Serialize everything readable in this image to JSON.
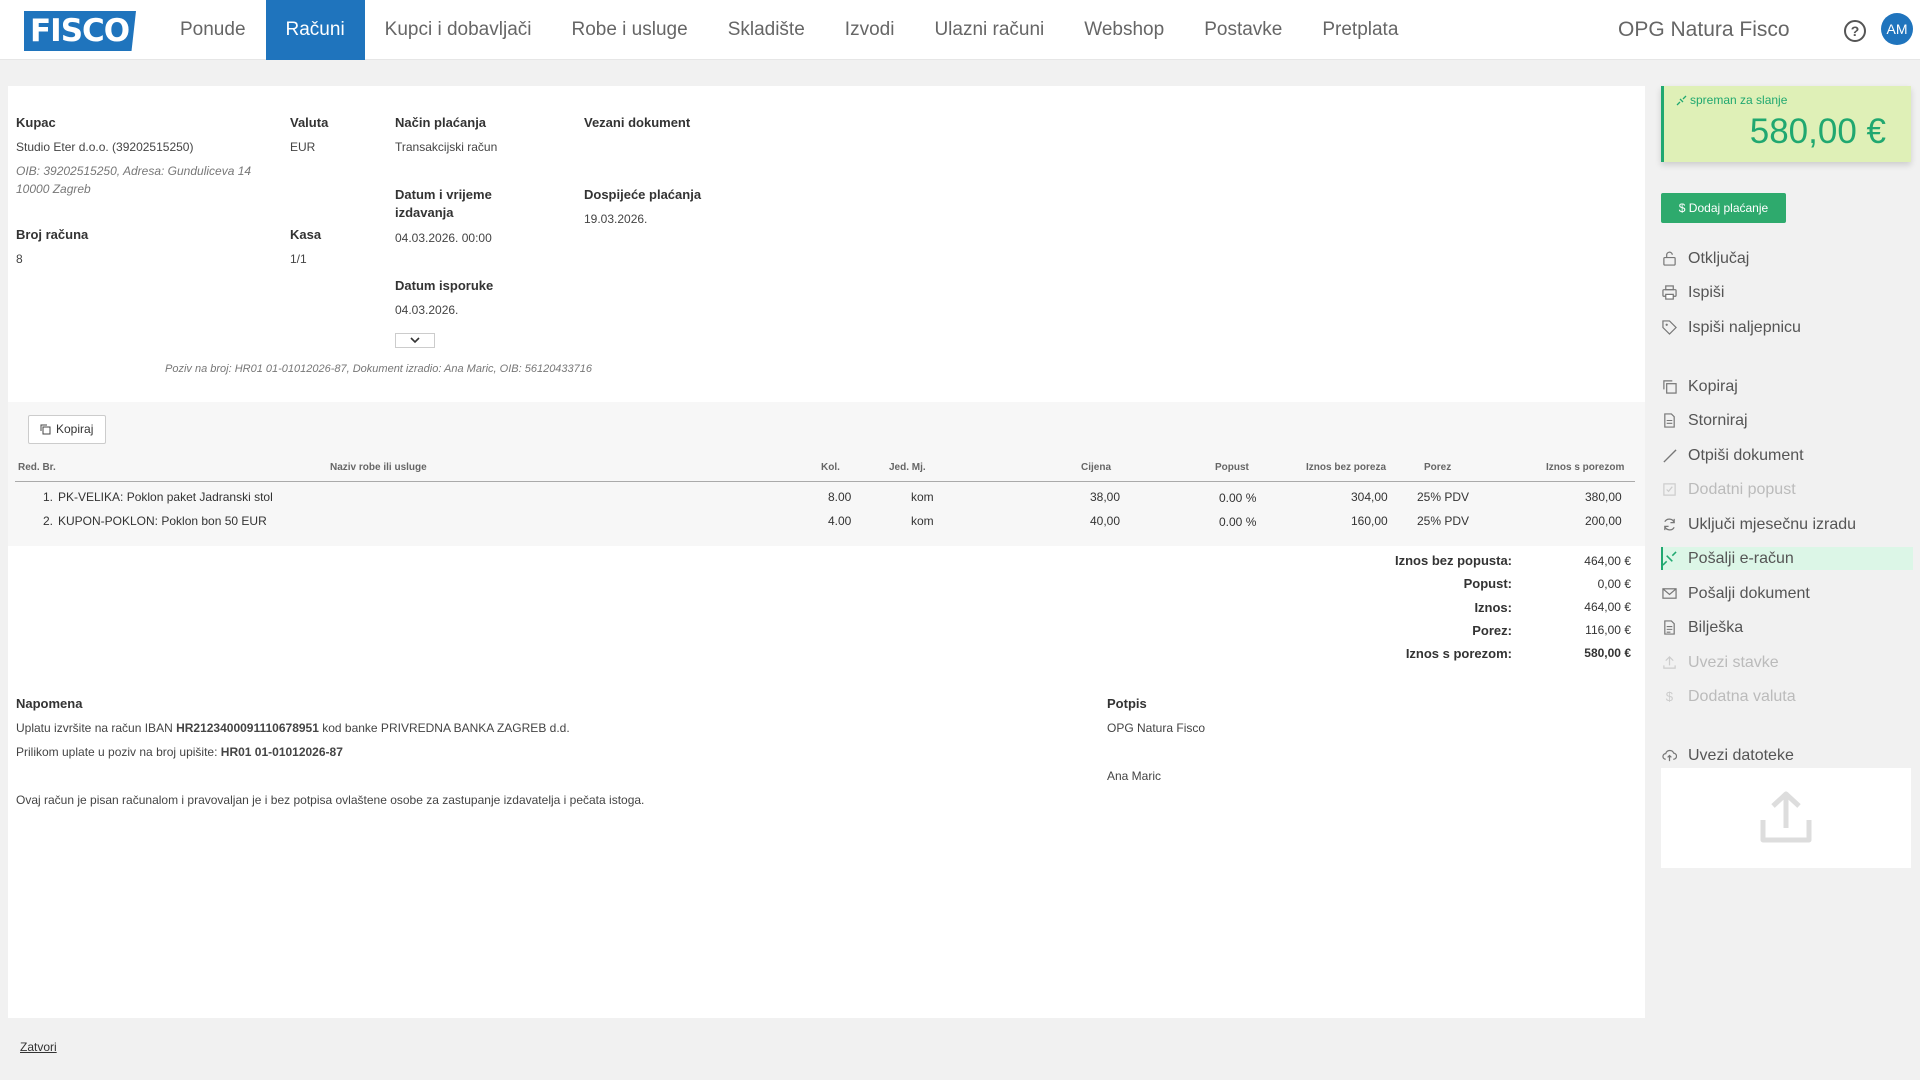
{
  "nav": {
    "logo": "FISCO",
    "items": [
      "Ponude",
      "Računi",
      "Kupci i dobavljači",
      "Robe i usluge",
      "Skladište",
      "Izvodi",
      "Ulazni računi",
      "Webshop",
      "Postavke",
      "Pretplata"
    ],
    "active": "Računi",
    "company": "OPG Natura Fisco",
    "avatar": "AM"
  },
  "invoice": {
    "kupac_label": "Kupac",
    "kupac": "Studio Eter d.o.o. (39202515250)",
    "kupac_detail_1": "OIB: 39202515250, Adresa: Gunduliceva 14",
    "kupac_detail_2": "10000 Zagreb",
    "valuta_label": "Valuta",
    "valuta": "EUR",
    "nacin_label": "Način plaćanja",
    "nacin": "Transakcijski račun",
    "vezani_label": "Vezani dokument",
    "datum_label_1": "Datum i vrijeme",
    "datum_label_2": "izdavanja",
    "datum": "04.03.2026. 00:00",
    "dospijece_label": "Dospijeće plaćanja",
    "dospijece": "19.03.2026.",
    "broj_label": "Broj računa",
    "broj": "8",
    "kasa_label": "Kasa",
    "kasa": "1/1",
    "isporuka_label": "Datum isporuke",
    "isporuka": "04.03.2026.",
    "poziv_line": "Poziv na broj: HR01 01-01012026-87, Dokument izradio: Ana Maric, OIB: 56120433716"
  },
  "items": {
    "copy_button": "Kopiraj",
    "headers": {
      "red": "Red. Br.",
      "naziv": "Naziv robe ili usluge",
      "kol": "Kol.",
      "jed": "Jed. Mj.",
      "cijena": "Cijena",
      "popust": "Popust",
      "bez_poreza": "Iznos bez poreza",
      "porez": "Porez",
      "s_porezom": "Iznos s porezom"
    },
    "rows": [
      {
        "rb": "1.",
        "naziv": "PK-VELIKA: Poklon paket Jadranski stol",
        "kol": "8.00",
        "jed": "kom",
        "cijena": "38,00",
        "popust": "0.00 %",
        "bez": "304,00",
        "porez": "25% PDV",
        "s": "380,00"
      },
      {
        "rb": "2.",
        "naziv": "KUPON-POKLON: Poklon bon 50 EUR",
        "kol": "4.00",
        "jed": "kom",
        "cijena": "40,00",
        "popust": "0.00 %",
        "bez": "160,00",
        "porez": "25% PDV",
        "s": "200,00"
      }
    ]
  },
  "totals": [
    {
      "label": "Iznos bez popusta:",
      "value": "464,00 €"
    },
    {
      "label": "Popust:",
      "value": "0,00 €"
    },
    {
      "label": "Iznos:",
      "value": "464,00 €"
    },
    {
      "label": "Porez:",
      "value": "116,00 €"
    },
    {
      "label": "Iznos s porezom:",
      "value": "580,00 €"
    }
  ],
  "notes": {
    "napomena_label": "Napomena",
    "line1_pre": "Uplatu izvršite na račun IBAN ",
    "iban": "HR2123400091110678951",
    "line1_post": " kod banke PRIVREDNA BANKA ZAGREB d.d.",
    "line2_pre": "Prilikom uplate u poziv na broj upišite: ",
    "poziv": "HR01 01-01012026-87",
    "line3": "Ovaj račun je pisan računalom i pravovaljan je i bez potpisa ovlaštene osobe za zastupanje izdavatelja i pečata istoga.",
    "potpis_label": "Potpis",
    "potpis_company": "OPG Natura Fisco",
    "potpis_person": "Ana Maric"
  },
  "sidebar": {
    "status": "spreman za slanje",
    "amount": "580,00 €",
    "add_payment": "$ Dodaj plaćanje",
    "actions": [
      {
        "label": "Otključaj",
        "icon": "lock-open-icon",
        "disabled": false
      },
      {
        "label": "Ispiši",
        "icon": "printer-icon",
        "disabled": false
      },
      {
        "label": "Ispiši naljepnicu",
        "icon": "tag-icon",
        "disabled": false
      },
      {
        "label": "Kopiraj",
        "icon": "copy-icon",
        "disabled": false
      },
      {
        "label": "Storniraj",
        "icon": "document-icon",
        "disabled": false
      },
      {
        "label": "Otpiši dokument",
        "icon": "slash-icon",
        "disabled": false
      },
      {
        "label": "Dodatni popust",
        "icon": "checkbox-icon",
        "disabled": true
      },
      {
        "label": "Uključi mjesečnu izradu",
        "icon": "refresh-icon",
        "disabled": false
      },
      {
        "label": "Pošalji e-račun",
        "icon": "send-link-icon",
        "disabled": false,
        "highlighted": true
      },
      {
        "label": "Pošalji dokument",
        "icon": "envelope-icon",
        "disabled": false
      },
      {
        "label": "Bilješka",
        "icon": "note-icon",
        "disabled": false
      },
      {
        "label": "Uvezi stavke",
        "icon": "upload-icon",
        "disabled": true
      },
      {
        "label": "Dodatna valuta",
        "icon": "dollar-icon",
        "disabled": true
      },
      {
        "label": "Uvezi datoteke",
        "icon": "cloud-upload-icon",
        "disabled": false
      }
    ]
  },
  "footer": {
    "close": "Zatvori"
  },
  "colors": {
    "brand": "#1f74bd",
    "success": "#20a870",
    "status_bg": "#dff0b7"
  }
}
